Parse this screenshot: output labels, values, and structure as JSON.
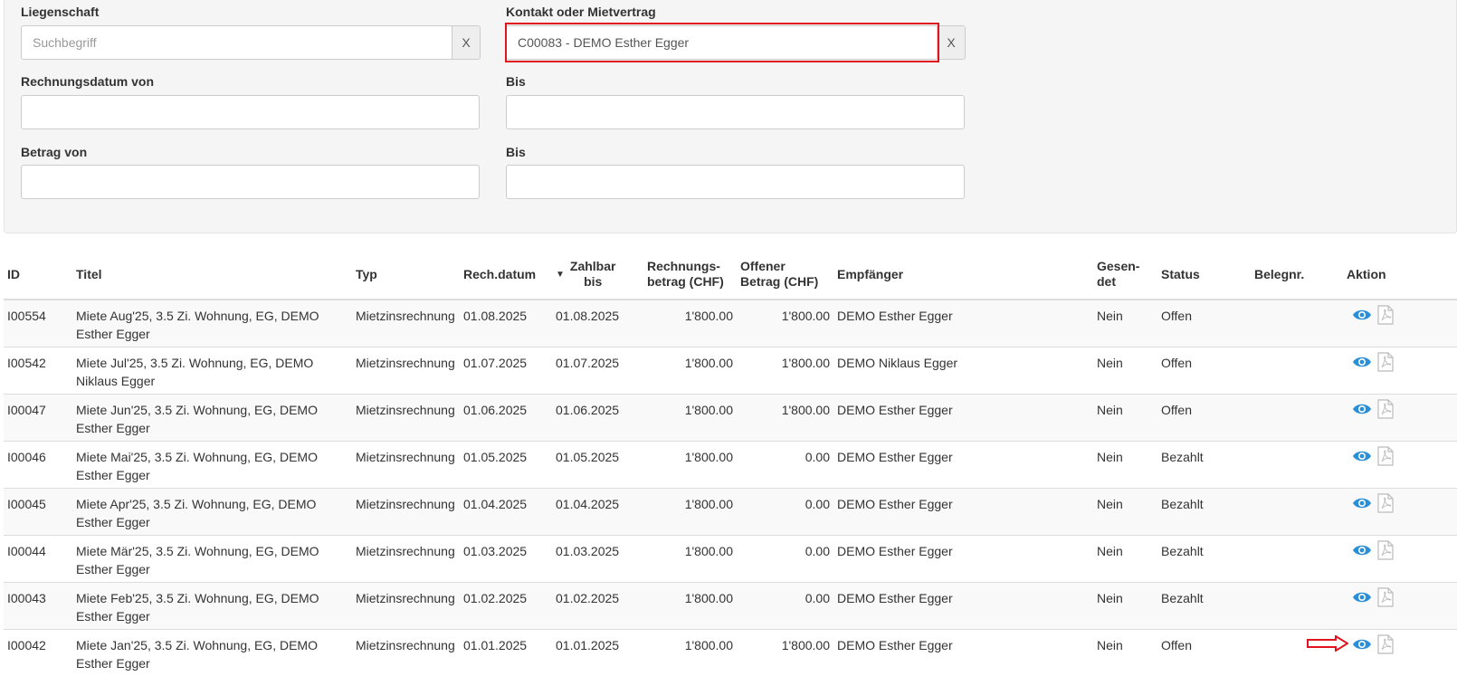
{
  "filters": {
    "property_label": "Liegenschaft",
    "property_placeholder": "Suchbegriff",
    "property_clear": "X",
    "contact_label": "Kontakt oder Mietvertrag",
    "contact_value": "C00083 - DEMO Esther Egger",
    "contact_clear": "X",
    "date_from_label": "Rechnungsdatum von",
    "date_to_label": "Bis",
    "amount_from_label": "Betrag von",
    "amount_to_label": "Bis"
  },
  "table": {
    "headers": {
      "id": "ID",
      "title": "Titel",
      "type": "Typ",
      "invoice_date": "Rech.datum",
      "payable_1": "Zahlbar",
      "payable_2": "bis",
      "amount_1": "Rechnungs-",
      "amount_2": "betrag (CHF)",
      "open_1": "Offener",
      "open_2": "Betrag (CHF)",
      "recipient": "Empfänger",
      "sent_1": "Gesen-",
      "sent_2": "det",
      "status": "Status",
      "receipt": "Belegnr.",
      "action": "Aktion"
    },
    "sort_indicator": "▼",
    "rows": [
      {
        "id": "I00554",
        "title": "Miete Aug'25, 3.5 Zi. Wohnung, EG, DEMO Esther Egger",
        "type": "Mietzinsrechnung",
        "date": "01.08.2025",
        "payable": "01.08.2025",
        "amount": "1'800.00",
        "open": "1'800.00",
        "recipient": "DEMO Esther Egger",
        "sent": "Nein",
        "status": "Offen",
        "receipt": ""
      },
      {
        "id": "I00542",
        "title": "Miete Jul'25, 3.5 Zi. Wohnung, EG, DEMO Niklaus Egger",
        "type": "Mietzinsrechnung",
        "date": "01.07.2025",
        "payable": "01.07.2025",
        "amount": "1'800.00",
        "open": "1'800.00",
        "recipient": "DEMO Niklaus Egger",
        "sent": "Nein",
        "status": "Offen",
        "receipt": ""
      },
      {
        "id": "I00047",
        "title": "Miete Jun'25, 3.5 Zi. Wohnung, EG, DEMO Esther Egger",
        "type": "Mietzinsrechnung",
        "date": "01.06.2025",
        "payable": "01.06.2025",
        "amount": "1'800.00",
        "open": "1'800.00",
        "recipient": "DEMO Esther Egger",
        "sent": "Nein",
        "status": "Offen",
        "receipt": ""
      },
      {
        "id": "I00046",
        "title": "Miete Mai'25, 3.5 Zi. Wohnung, EG, DEMO Esther Egger",
        "type": "Mietzinsrechnung",
        "date": "01.05.2025",
        "payable": "01.05.2025",
        "amount": "1'800.00",
        "open": "0.00",
        "recipient": "DEMO Esther Egger",
        "sent": "Nein",
        "status": "Bezahlt",
        "receipt": ""
      },
      {
        "id": "I00045",
        "title": "Miete Apr'25, 3.5 Zi. Wohnung, EG, DEMO Esther Egger",
        "type": "Mietzinsrechnung",
        "date": "01.04.2025",
        "payable": "01.04.2025",
        "amount": "1'800.00",
        "open": "0.00",
        "recipient": "DEMO Esther Egger",
        "sent": "Nein",
        "status": "Bezahlt",
        "receipt": ""
      },
      {
        "id": "I00044",
        "title": "Miete Mär'25, 3.5 Zi. Wohnung, EG, DEMO Esther Egger",
        "type": "Mietzinsrechnung",
        "date": "01.03.2025",
        "payable": "01.03.2025",
        "amount": "1'800.00",
        "open": "0.00",
        "recipient": "DEMO Esther Egger",
        "sent": "Nein",
        "status": "Bezahlt",
        "receipt": ""
      },
      {
        "id": "I00043",
        "title": "Miete Feb'25, 3.5 Zi. Wohnung, EG, DEMO Esther Egger",
        "type": "Mietzinsrechnung",
        "date": "01.02.2025",
        "payable": "01.02.2025",
        "amount": "1'800.00",
        "open": "0.00",
        "recipient": "DEMO Esther Egger",
        "sent": "Nein",
        "status": "Bezahlt",
        "receipt": ""
      },
      {
        "id": "I00042",
        "title": "Miete Jan'25, 3.5 Zi. Wohnung, EG, DEMO Esther Egger",
        "type": "Mietzinsrechnung",
        "date": "01.01.2025",
        "payable": "01.01.2025",
        "amount": "1'800.00",
        "open": "1'800.00",
        "recipient": "DEMO Esther Egger",
        "sent": "Nein",
        "status": "Offen",
        "receipt": ""
      }
    ],
    "row_actions": [
      "eye-icon",
      "pdf-icon"
    ]
  },
  "colors": {
    "highlight": "#e0141e",
    "eye_icon": "#2a8fd6",
    "pdf_icon": "#bbbbbb"
  }
}
